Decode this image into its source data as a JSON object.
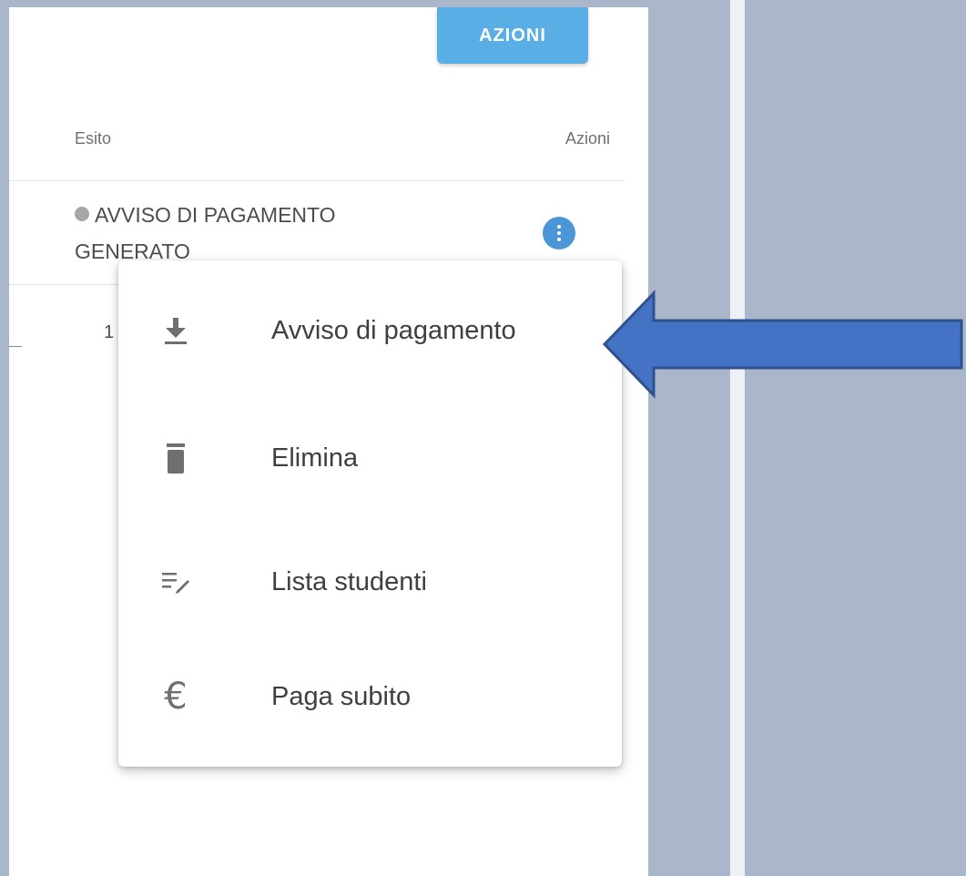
{
  "toolbar": {
    "azioni_label": "AZIONI"
  },
  "table": {
    "columns": [
      {
        "label": "Esito"
      },
      {
        "label": "Azioni"
      }
    ],
    "rows": [
      {
        "status_dot_color": "#a6a6a6",
        "esito_line1": "AVVISO DI PAGAMENTO",
        "esito_line2": "GENERATO"
      },
      {
        "partial_value": "1"
      }
    ],
    "kebab_icon": "more-vert-icon"
  },
  "menu": {
    "items": [
      {
        "icon": "download-icon",
        "label": "Avviso di pagamento"
      },
      {
        "icon": "trash-icon",
        "label": "Elimina"
      },
      {
        "icon": "list-edit-icon",
        "label": "Lista studenti"
      },
      {
        "icon": "euro-icon",
        "glyph": "€",
        "label": "Paga subito"
      }
    ]
  },
  "annotation": {
    "arrow_color": "#4472c4",
    "arrow_border": "#2f528f"
  },
  "colors": {
    "background": "#aab6ca",
    "accent_button": "#5aaee6",
    "kebab_button": "#4a96d6",
    "icon_gray": "#6f6f6f"
  }
}
